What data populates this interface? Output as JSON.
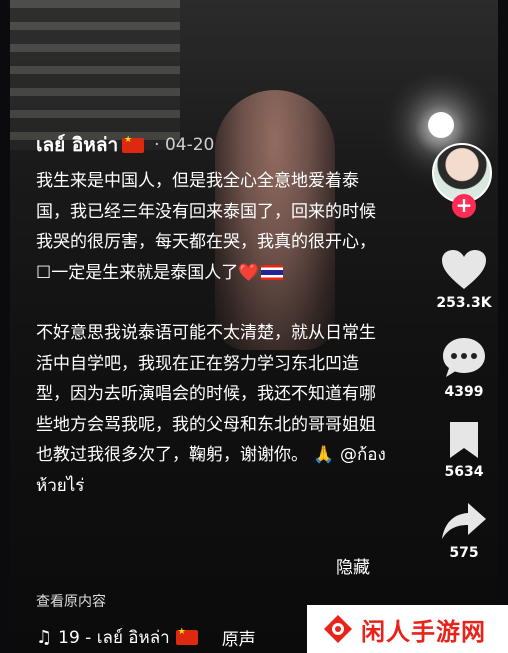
{
  "post": {
    "author": "เลย์ อิหล่า",
    "date": "04-20",
    "caption_p1": "我生来是中国人，但是我全心全意地爱着泰国，我已经三年没有回来泰国了，回来的时候我哭的很厉害，每天都在哭，我真的很开心，☐一定是生来就是泰国人了",
    "caption_p2": "不好意思我说泰语可能不太清楚，就从日常生活中自学吧，我现在正在努力学习东北凹造型，因为去听演唱会的时候，我还不知道有哪些地方会骂我呢，我的父母和东北的哥哥姐姐也教过我很多次了，鞠躬，谢谢你。",
    "caption_p2_pray": "🙏",
    "caption_p2_mention": "@ก้องห้วยไร่",
    "heart_emoji": "❤️",
    "hide_label": "隐藏",
    "view_original_label": "查看原内容",
    "music_text": "19 - เลย์ อิหล่า",
    "original_sound_label": "原声"
  },
  "actions": {
    "likes": "253.3K",
    "comments": "4399",
    "saves": "5634",
    "shares": "575"
  },
  "icons": {
    "follow": "plus-icon",
    "like": "heart-icon",
    "comment": "comment-icon",
    "save": "bookmark-icon",
    "share": "share-icon",
    "music": "music-note-icon"
  },
  "watermark": {
    "text": "闲人手游网"
  },
  "colors": {
    "follow_button": "#fe2c55",
    "watermark_text": "#e8231a",
    "flag_cn": "#de2910"
  }
}
